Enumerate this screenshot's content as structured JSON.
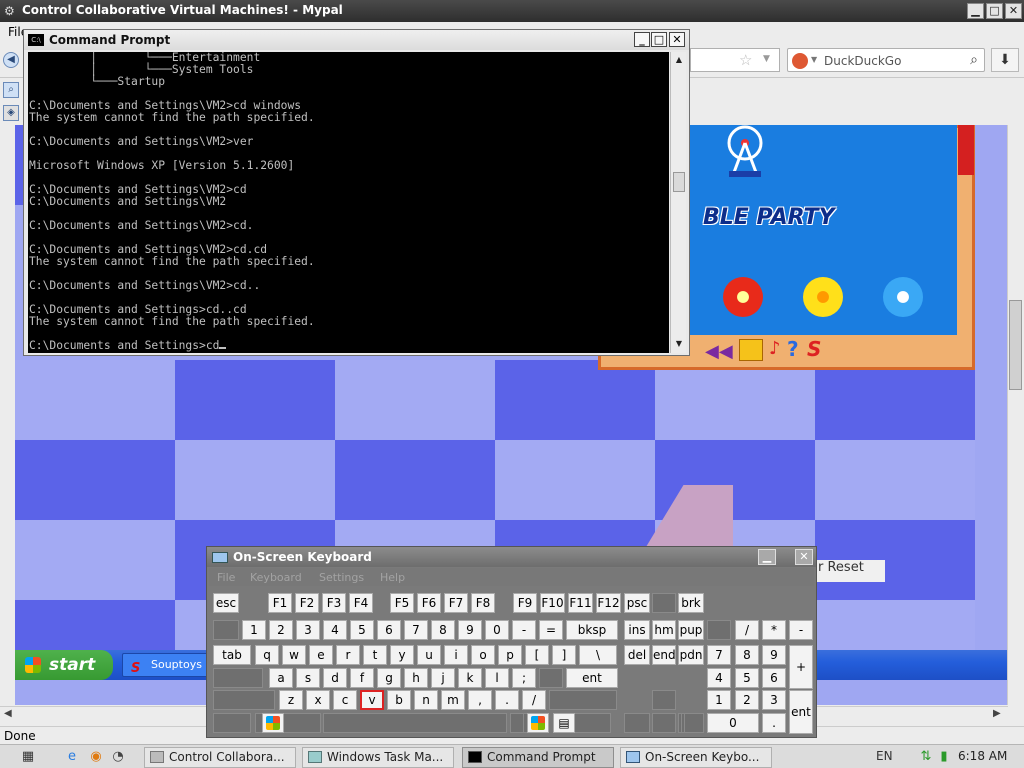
{
  "browser": {
    "title": "Control Collaborative Virtual Machines! - Mypal",
    "menu_first": "File",
    "search_placeholder": "DuckDuckGo",
    "status": "Done",
    "reset_label": "r Reset"
  },
  "remote_taskbar": {
    "start_label": "start",
    "task_label": "Souptoys"
  },
  "game": {
    "banner_text": "BLE PARTY"
  },
  "cmd": {
    "title": "Command Prompt",
    "lines": [
      "         │       └───Entertainment",
      "         │       └───System Tools",
      "         └───Startup",
      "",
      "C:\\Documents and Settings\\VM2>cd windows",
      "The system cannot find the path specified.",
      "",
      "C:\\Documents and Settings\\VM2>ver",
      "",
      "Microsoft Windows XP [Version 5.1.2600]",
      "",
      "C:\\Documents and Settings\\VM2>cd",
      "C:\\Documents and Settings\\VM2",
      "",
      "C:\\Documents and Settings\\VM2>cd.",
      "",
      "C:\\Documents and Settings\\VM2>cd.cd",
      "The system cannot find the path specified.",
      "",
      "C:\\Documents and Settings\\VM2>cd..",
      "",
      "C:\\Documents and Settings>cd..cd",
      "The system cannot find the path specified.",
      "",
      "C:\\Documents and Settings>cd"
    ]
  },
  "osk": {
    "title": "On-Screen Keyboard",
    "menu": [
      "File",
      "Keyboard",
      "Settings",
      "Help"
    ],
    "highlighted_key": "v",
    "rows": {
      "fn": [
        "esc",
        "F1",
        "F2",
        "F3",
        "F4",
        "F5",
        "F6",
        "F7",
        "F8",
        "F9",
        "F10",
        "F11",
        "F12",
        "psc",
        "",
        "brk"
      ],
      "num": [
        "",
        "1",
        "2",
        "3",
        "4",
        "5",
        "6",
        "7",
        "8",
        "9",
        "0",
        "-",
        "=",
        "bksp",
        "ins",
        "hm",
        "pup",
        "",
        "/",
        "*",
        "-"
      ],
      "tab": [
        "tab",
        "q",
        "w",
        "e",
        "r",
        "t",
        "y",
        "u",
        "i",
        "o",
        "p",
        "[",
        "]",
        "\\",
        "del",
        "end",
        "pdn",
        "7",
        "8",
        "9",
        "+"
      ],
      "caps": [
        "",
        "a",
        "s",
        "d",
        "f",
        "g",
        "h",
        "j",
        "k",
        "l",
        ";",
        "",
        "ent",
        "4",
        "5",
        "6"
      ],
      "shift": [
        "",
        "z",
        "x",
        "c",
        "v",
        "b",
        "n",
        "m",
        ",",
        ".",
        "/",
        "",
        "",
        "1",
        "2",
        "3",
        "ent"
      ],
      "ctrl": [
        "",
        "",
        "",
        "",
        "",
        "",
        "",
        "",
        "",
        "",
        "",
        "0",
        "."
      ]
    }
  },
  "host_taskbar": {
    "tasks": [
      "Control Collabora...",
      "Windows Task Ma...",
      "Command Prompt",
      "On-Screen Keybo..."
    ],
    "language": "EN",
    "clock": "6:18 AM"
  }
}
